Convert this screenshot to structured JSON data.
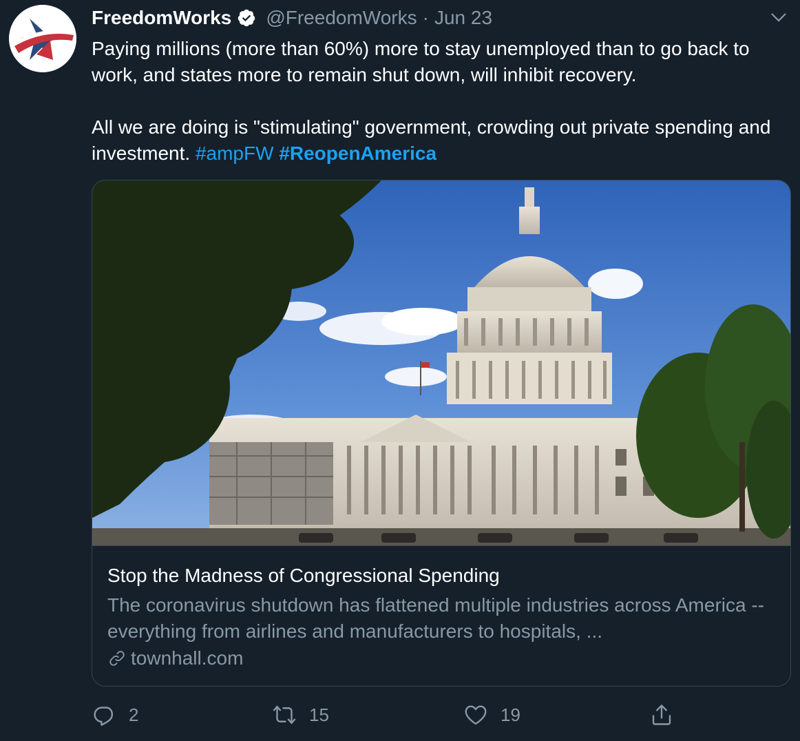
{
  "tweet": {
    "author_name": "FreedomWorks",
    "handle": "@FreedomWorks",
    "separator": "·",
    "date": "Jun 23",
    "text_line1": "Paying millions (more than 60%) more to stay unemployed than to go back to work, and states more to remain shut down, will inhibit recovery.",
    "text_line2": "All we are doing is \"stimulating\" government, crowding out private spending and investment.",
    "hashtag1": "#ampFW",
    "hashtag2": "#ReopenAmerica"
  },
  "card": {
    "title": "Stop the Madness of Congressional Spending",
    "description": "The coronavirus shutdown has flattened multiple industries across America -- everything from airlines and manufacturers to hospitals, ...",
    "domain": "townhall.com"
  },
  "actions": {
    "reply_count": "2",
    "retweet_count": "15",
    "like_count": "19"
  },
  "colors": {
    "background": "#15202b",
    "text": "#ffffff",
    "muted": "#8899a6",
    "link": "#1da1f2",
    "border": "#38444d"
  },
  "icons": [
    "freedomworks-logo",
    "verified-badge-icon",
    "chevron-down-icon",
    "link-icon",
    "reply-icon",
    "retweet-icon",
    "like-icon",
    "share-icon"
  ]
}
